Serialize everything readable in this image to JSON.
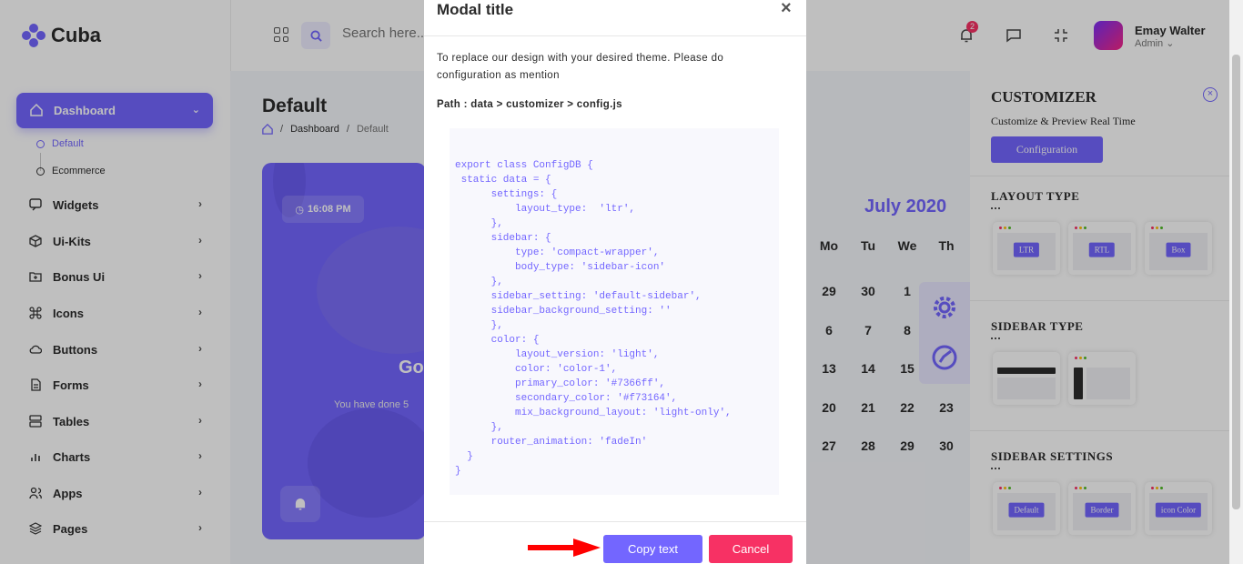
{
  "header": {
    "logo_text": "Cuba",
    "search_placeholder": "Search here...",
    "notification_count": "2",
    "user_name": "Emay Walter",
    "user_role": "Admin"
  },
  "sidebar": {
    "active_item": "Dashboard",
    "sub_items": [
      "Default",
      "Ecommerce"
    ],
    "items": [
      "Widgets",
      "Ui-Kits",
      "Bonus Ui",
      "Icons",
      "Buttons",
      "Forms",
      "Tables",
      "Charts",
      "Apps",
      "Pages"
    ]
  },
  "main": {
    "page_title": "Default",
    "breadcrumb": [
      "Dashboard",
      "Default"
    ],
    "card_time": "16:08 PM",
    "card_greeting": "Go",
    "card_done": "You have done 5"
  },
  "calendar": {
    "month": "July 2020",
    "weekdays": [
      "Mo",
      "Tu",
      "We",
      "Th"
    ],
    "rows": [
      [
        "29",
        "30",
        "1",
        ""
      ],
      [
        "6",
        "7",
        "8",
        ""
      ],
      [
        "13",
        "14",
        "15",
        ""
      ],
      [
        "20",
        "21",
        "22",
        "23"
      ],
      [
        "27",
        "28",
        "29",
        "30"
      ]
    ]
  },
  "customizer": {
    "title": "CUSTOMIZER",
    "subtitle": "Customize & Preview Real Time",
    "config_button": "Configuration",
    "layout_type": {
      "heading": "LAYOUT TYPE",
      "options": [
        "LTR",
        "RTL",
        "Box"
      ]
    },
    "sidebar_type": {
      "heading": "SIDEBAR TYPE"
    },
    "sidebar_settings": {
      "heading": "SIDEBAR SETTINGS",
      "options": [
        "Default",
        "Border",
        "icon Color"
      ]
    }
  },
  "modal": {
    "title": "Modal title",
    "close": "×",
    "description": "To replace our design with your desired theme. Please do configuration as mention",
    "path": "Path : data > customizer > config.js",
    "code": "export class ConfigDB {\n static data = {\n      settings: {\n          layout_type:  'ltr',\n      },\n      sidebar: {\n          type: 'compact-wrapper',\n          body_type: 'sidebar-icon'\n      },\n      sidebar_setting: 'default-sidebar',\n      sidebar_background_setting: ''\n      },\n      color: {\n          layout_version: 'light',\n          color: 'color-1',\n          primary_color: '#7366ff',\n          secondary_color: '#f73164',\n          mix_background_layout: 'light-only',\n      },\n      router_animation: 'fadeIn'\n  }\n}",
    "copy_button": "Copy text",
    "cancel_button": "Cancel"
  },
  "colors": {
    "primary": "#7366ff",
    "secondary": "#f73164",
    "arrow": "#ff0000"
  }
}
